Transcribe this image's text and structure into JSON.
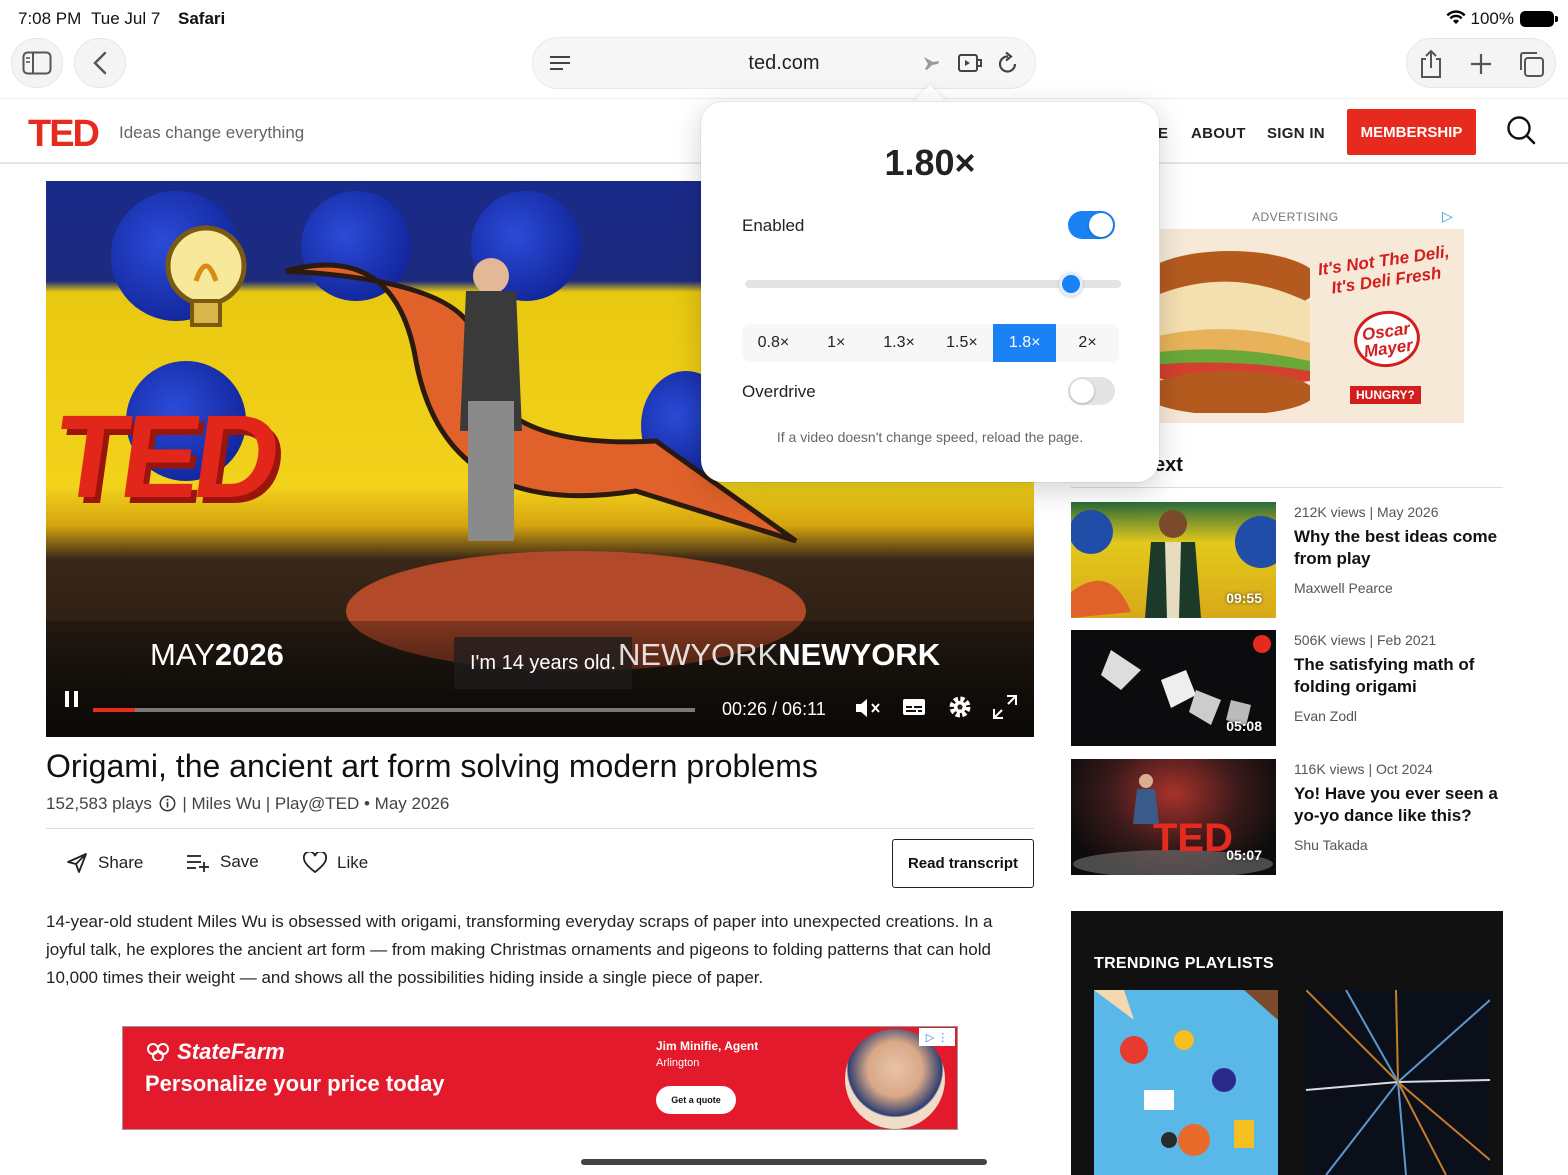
{
  "status_bar": {
    "time": "7:08 PM",
    "date": "Tue Jul 7",
    "app": "Safari",
    "battery": "100%"
  },
  "browser": {
    "url": "ted.com"
  },
  "site": {
    "logo": "TED",
    "tagline": "Ideas change everything",
    "nav_partial": "E",
    "nav": [
      "ABOUT",
      "SIGN IN"
    ],
    "membership": "MEMBERSHIP",
    "brand_color": "#e62b1e"
  },
  "video": {
    "overlay_date_light": "MAY",
    "overlay_date_bold": "2026",
    "overlay_city_light": "NEWYORK",
    "overlay_city_bold": "NEWYORK",
    "stage_sign": "TED",
    "subtitle": "I'm 14 years old.",
    "current_time": "00:26",
    "duration": "06:11",
    "time_display": "00:26 / 06:11",
    "progress_fraction": 0.07
  },
  "talk": {
    "title": "Origami, the ancient art form solving modern problems",
    "plays": "152,583 plays",
    "meta_rest": "| Miles Wu | Play@TED • May 2026",
    "actions": {
      "share": "Share",
      "save": "Save",
      "like": "Like"
    },
    "transcript_button": "Read transcript",
    "description": "14-year-old student Miles Wu is obsessed with origami, transforming everyday scraps of paper into unexpected creations. In a joyful talk, he explores the ancient art form — from making Christmas ornaments and pigeons to folding patterns that can hold 10,000 times their weight — and shows all the possibilities hiding inside a single piece of paper."
  },
  "ad_bottom": {
    "brand": "StateFarm",
    "headline": "Personalize your price today",
    "agent": "Jim Minifie, Agent",
    "city": "Arlington",
    "cta": "Get a quote"
  },
  "ad_side": {
    "label": "ADVERTISING",
    "slogan": "It's Not The Deli, It's Deli Fresh",
    "logo": "Oscar Mayer",
    "badge": "HUNGRY?"
  },
  "up_next": {
    "heading_partial": "ext",
    "items": [
      {
        "meta": "212K views | May 2026",
        "title": "Why the best ideas come from play",
        "speaker": "Maxwell Pearce",
        "duration": "09:55"
      },
      {
        "meta": "506K views | Feb 2021",
        "title": "The satisfying math of folding origami",
        "speaker": "Evan Zodl",
        "duration": "05:08"
      },
      {
        "meta": "116K views | Oct 2024",
        "title": "Yo! Have you ever seen a yo-yo dance like this?",
        "speaker": "Shu Takada",
        "duration": "05:07"
      }
    ]
  },
  "trending": {
    "heading": "TRENDING PLAYLISTS"
  },
  "speed_popover": {
    "speed": "1.80×",
    "enabled_label": "Enabled",
    "enabled": true,
    "slider_value": 1.8,
    "slider_min": 0.5,
    "slider_max": 2.0,
    "presets": [
      "0.8×",
      "1×",
      "1.3×",
      "1.5×",
      "1.8×",
      "2×"
    ],
    "active_preset": "1.8×",
    "overdrive_label": "Overdrive",
    "overdrive": false,
    "hint": "If a video doesn't change speed, reload the page.",
    "accent": "#1a82f5"
  }
}
